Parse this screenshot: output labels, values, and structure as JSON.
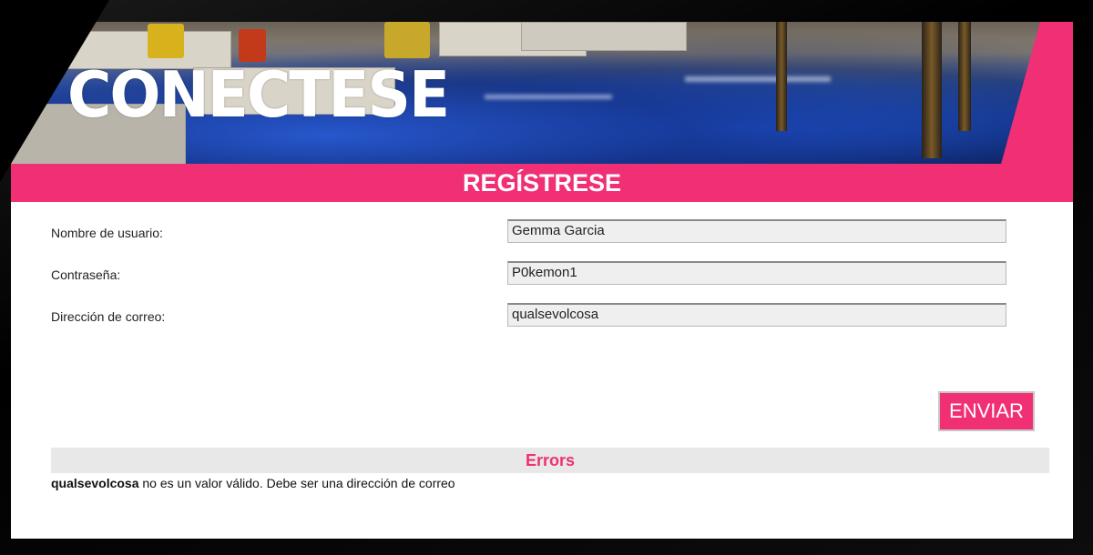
{
  "banner": {
    "title": "CONECTESE"
  },
  "form": {
    "heading": "REGÍSTRESE",
    "fields": [
      {
        "label": "Nombre de usuario:",
        "value": "Gemma Garcia"
      },
      {
        "label": "Contraseña:",
        "value": "P0kemon1"
      },
      {
        "label": "Dirección de correo:",
        "value": "qualsevolcosa"
      }
    ],
    "submit_label": "ENVIAR"
  },
  "errors": {
    "title": "Errors",
    "messages": [
      {
        "value": "qualsevolcosa",
        "text": " no es un valor válido. Debe ser una dirección de correo"
      }
    ]
  },
  "colors": {
    "accent": "#f12f75",
    "error_bar": "#e8e8e8"
  }
}
